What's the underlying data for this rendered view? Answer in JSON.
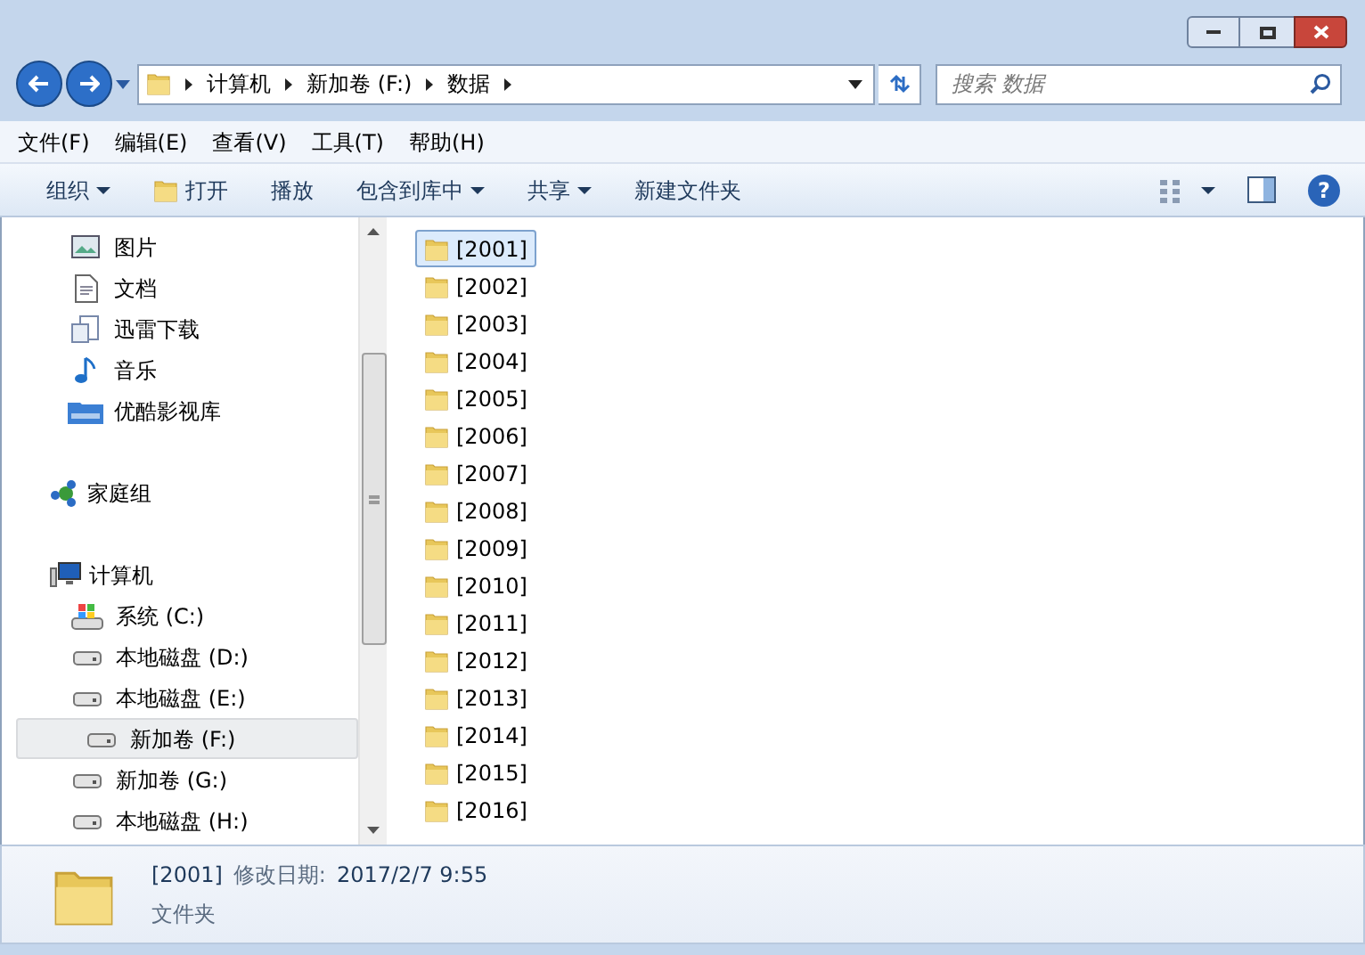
{
  "address_bar": {
    "path": [
      "计算机",
      "新加卷 (F:)",
      "数据"
    ]
  },
  "search": {
    "placeholder": "搜索 数据"
  },
  "menu": [
    "文件(F)",
    "编辑(E)",
    "查看(V)",
    "工具(T)",
    "帮助(H)"
  ],
  "toolbar": [
    {
      "label": "组织",
      "icon": false,
      "dropdown": true
    },
    {
      "label": "打开",
      "icon": true,
      "dropdown": false
    },
    {
      "label": "播放",
      "icon": false,
      "dropdown": false
    },
    {
      "label": "包含到库中",
      "icon": false,
      "dropdown": true
    },
    {
      "label": "共享",
      "icon": false,
      "dropdown": true
    },
    {
      "label": "新建文件夹",
      "icon": false,
      "dropdown": false
    }
  ],
  "sidebar": {
    "libraries": [
      {
        "label": "图片",
        "kind": "picture"
      },
      {
        "label": "文档",
        "kind": "document"
      },
      {
        "label": "迅雷下载",
        "kind": "download"
      },
      {
        "label": "音乐",
        "kind": "music"
      },
      {
        "label": "优酷影视库",
        "kind": "video"
      }
    ],
    "homegroup": {
      "label": "家庭组"
    },
    "computer": {
      "label": "计算机",
      "children": [
        {
          "label": "系统 (C:)",
          "kind": "system",
          "selected": false
        },
        {
          "label": "本地磁盘 (D:)",
          "kind": "drive",
          "selected": false
        },
        {
          "label": "本地磁盘 (E:)",
          "kind": "drive",
          "selected": false
        },
        {
          "label": "新加卷 (F:)",
          "kind": "drive",
          "selected": true
        },
        {
          "label": "新加卷 (G:)",
          "kind": "drive",
          "selected": false
        },
        {
          "label": "本地磁盘 (H:)",
          "kind": "drive",
          "selected": false
        }
      ]
    }
  },
  "files": [
    {
      "name": "[2001]",
      "selected": true
    },
    {
      "name": "[2002]",
      "selected": false
    },
    {
      "name": "[2003]",
      "selected": false
    },
    {
      "name": "[2004]",
      "selected": false
    },
    {
      "name": "[2005]",
      "selected": false
    },
    {
      "name": "[2006]",
      "selected": false
    },
    {
      "name": "[2007]",
      "selected": false
    },
    {
      "name": "[2008]",
      "selected": false
    },
    {
      "name": "[2009]",
      "selected": false
    },
    {
      "name": "[2010]",
      "selected": false
    },
    {
      "name": "[2011]",
      "selected": false
    },
    {
      "name": "[2012]",
      "selected": false
    },
    {
      "name": "[2013]",
      "selected": false
    },
    {
      "name": "[2014]",
      "selected": false
    },
    {
      "name": "[2015]",
      "selected": false
    },
    {
      "name": "[2016]",
      "selected": false
    }
  ],
  "help_button": "?",
  "details": {
    "name": "[2001]",
    "date_label": "修改日期:",
    "date": "2017/2/7 9:55",
    "type": "文件夹"
  }
}
